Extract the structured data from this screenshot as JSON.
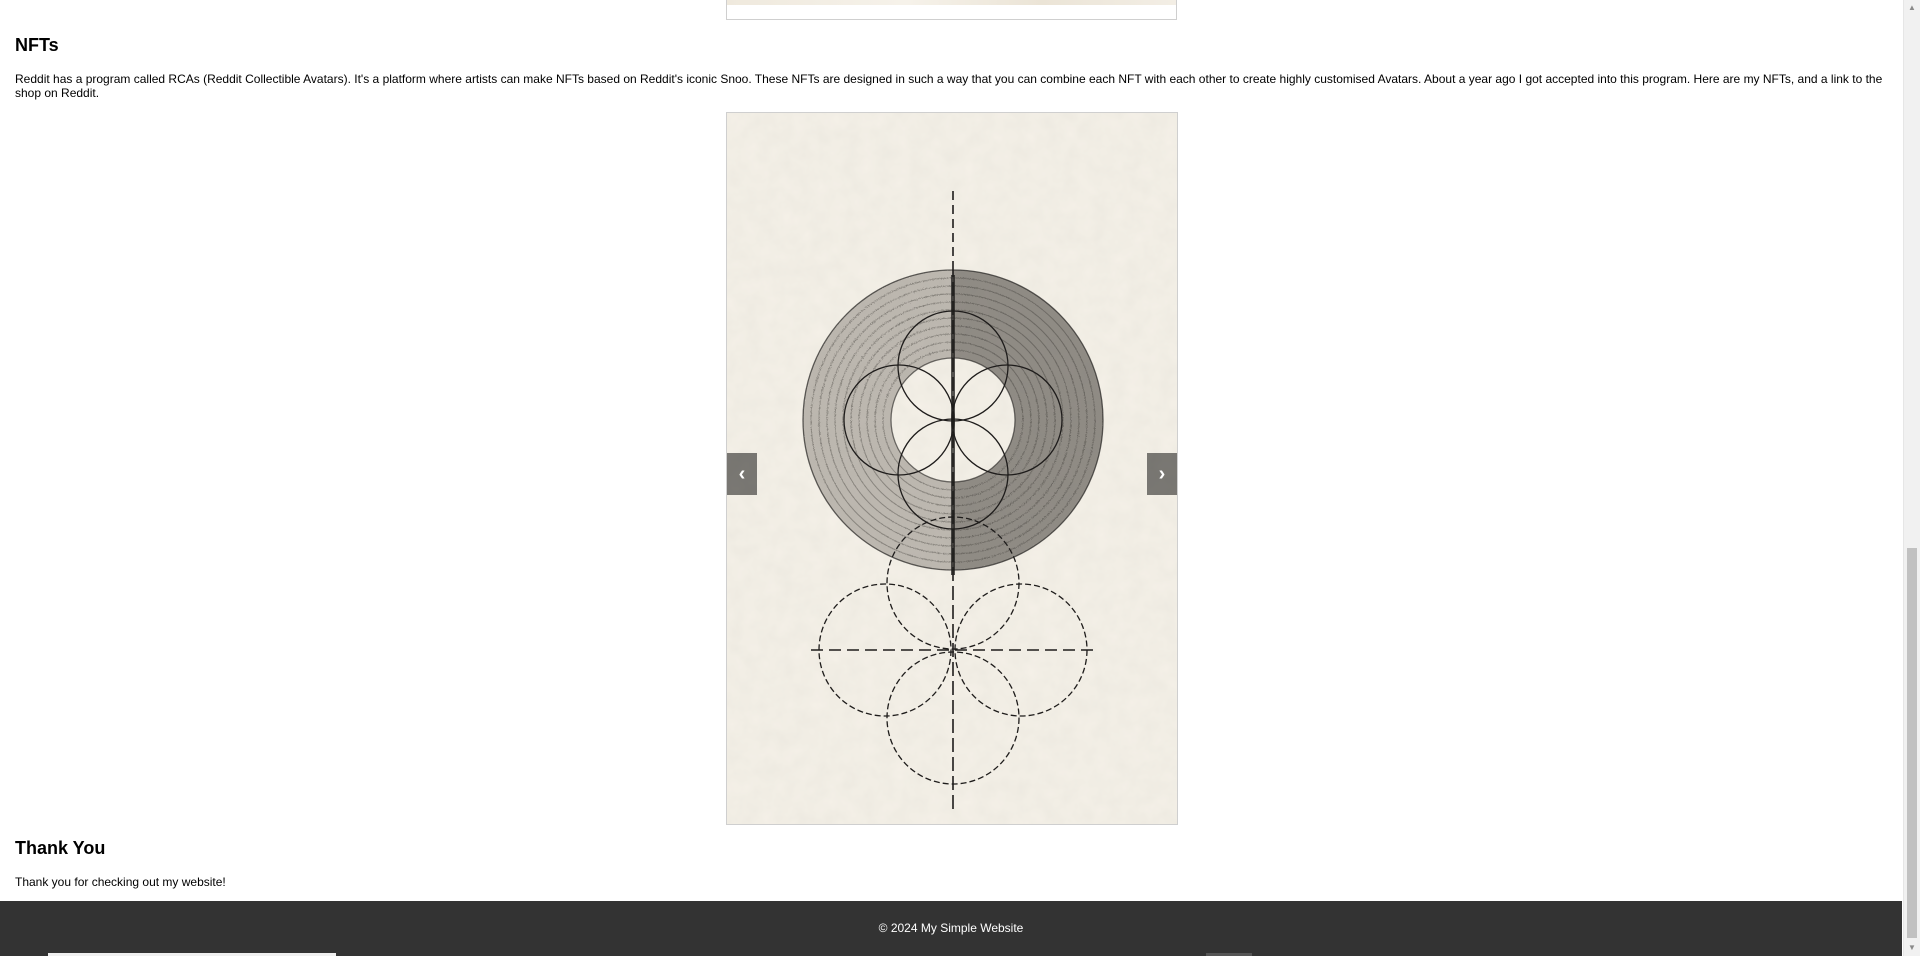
{
  "sections": {
    "nfts": {
      "heading": "NFTs",
      "text": "Reddit has a program called RCAs (Reddit Collectible Avatars). It's a platform where artists can make NFTs based on Reddit's iconic Snoo. These NFTs are designed in such a way that you can combine each NFT with each other to create highly customised Avatars. About a year ago I got accepted into this program. Here are my NFTs, and a link to the shop on Reddit."
    },
    "thanks": {
      "heading": "Thank You",
      "text": "Thank you for checking out my website!"
    }
  },
  "carousel": {
    "prev_label": "‹",
    "next_label": "›",
    "slide_icon": "geometric-circles-artwork"
  },
  "footer": {
    "text": "© 2024 My Simple Website"
  },
  "scrollbar": {
    "up_arrow": "▲",
    "down_arrow": "▼"
  }
}
